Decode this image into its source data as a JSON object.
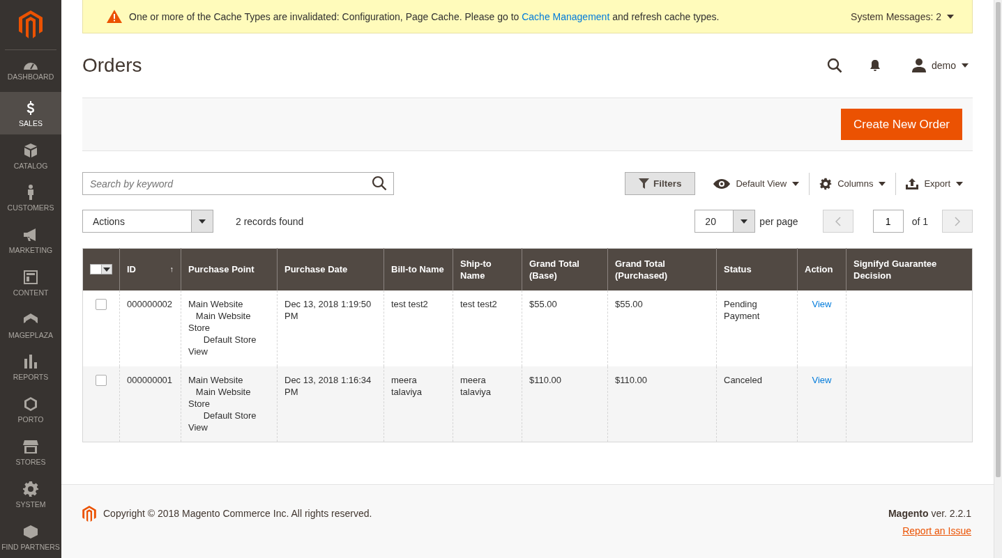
{
  "sidebar": {
    "items": [
      {
        "label": "DASHBOARD",
        "selected": false
      },
      {
        "label": "SALES",
        "selected": true
      },
      {
        "label": "CATALOG",
        "selected": false
      },
      {
        "label": "CUSTOMERS",
        "selected": false
      },
      {
        "label": "MARKETING",
        "selected": false
      },
      {
        "label": "CONTENT",
        "selected": false
      },
      {
        "label": "MAGEPLAZA",
        "selected": false
      },
      {
        "label": "REPORTS",
        "selected": false
      },
      {
        "label": "PORTO",
        "selected": false
      },
      {
        "label": "STORES",
        "selected": false
      },
      {
        "label": "SYSTEM",
        "selected": false
      },
      {
        "label": "FIND PARTNERS",
        "selected": false
      }
    ]
  },
  "system_message": {
    "text_before": "One or more of the Cache Types are invalidated: Configuration, Page Cache. Please go to",
    "link": "Cache Management",
    "text_after": "and refresh cache types.",
    "counter": "System Messages: 2"
  },
  "header": {
    "title": "Orders",
    "user": "demo"
  },
  "page_actions": {
    "primary_button": "Create New Order"
  },
  "toolbar": {
    "search": {
      "placeholder": "Search by keyword"
    },
    "filters_button": "Filters",
    "view": "Default View",
    "columns": "Columns",
    "export": "Export",
    "actions": "Actions",
    "records": "2 records found",
    "page_size": "20",
    "per_page": "per page",
    "page": "1",
    "of_pages": "of 1"
  },
  "table": {
    "columns": [
      "ID",
      "Purchase Point",
      "Purchase Date",
      "Bill-to Name",
      "Ship-to Name",
      "Grand Total (Base)",
      "Grand Total (Purchased)",
      "Status",
      "Action",
      "Signifyd Guarantee Decision"
    ],
    "sort_arrow": "↑",
    "rows": [
      {
        "checked": false,
        "id": "000000002",
        "purchase_point": "Main Website\n   Main Website Store\n      Default Store View",
        "purchase_date": "Dec 13, 2018 1:19:50 PM",
        "bill_to": "test test2",
        "ship_to": "test test2",
        "total_base": "$55.00",
        "total_purchased": "$55.00",
        "status": "Pending Payment",
        "action": "View"
      },
      {
        "checked": false,
        "id": "000000001",
        "purchase_point": "Main Website\n   Main Website Store\n      Default Store View",
        "purchase_date": "Dec 13, 2018 1:16:34 PM",
        "bill_to": "meera talaviya",
        "ship_to": "meera talaviya",
        "total_base": "$110.00",
        "total_purchased": "$110.00",
        "status": "Canceled",
        "action": "View"
      }
    ]
  },
  "footer": {
    "copyright": "Copyright © 2018 Magento Commerce Inc. All rights reserved.",
    "brand": "Magento",
    "version": "ver. 2.2.1",
    "report_link": "Report an Issue"
  }
}
